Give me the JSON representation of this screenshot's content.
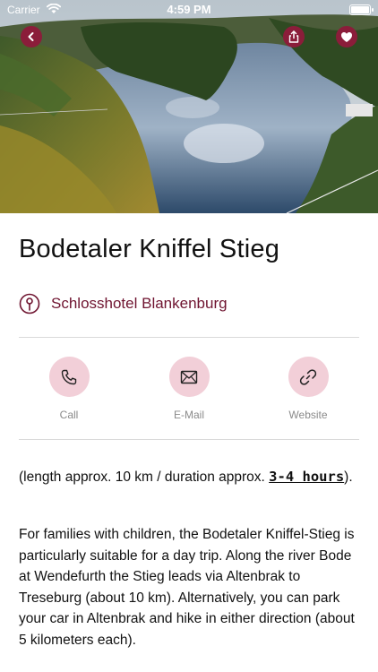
{
  "status_bar": {
    "carrier": "Carrier",
    "time": "4:59 PM"
  },
  "header": {
    "back_icon": "chevron-left-icon",
    "share_icon": "share-icon",
    "favorite_icon": "heart-icon",
    "accent_color": "#8b1d3a"
  },
  "hero": {
    "description_icon": "landscape-photo"
  },
  "place": {
    "title": "Bodetaler Kniffel Stieg",
    "location_icon": "map-pin-icon",
    "location": "Schlosshotel Blankenburg"
  },
  "actions": [
    {
      "label": "Call",
      "icon": "phone-icon"
    },
    {
      "label": "E-Mail",
      "icon": "mail-icon"
    },
    {
      "label": "Website",
      "icon": "link-icon"
    }
  ],
  "description": {
    "p1_prefix": "(length approx. 10 km / duration approx. ",
    "p1_bold": "3-4 hours",
    "p1_suffix": ").",
    "p2": "For families with children, the Bodetaler Kniffel-Stieg is particularly suitable for a day trip. Along the river Bode at Wendefurth the Stieg leads via Altenbrak to Treseburg (about 10 km). Alternatively, you can park your car in Altenbrak and hike in either direction (about 5 kilometers each)."
  }
}
